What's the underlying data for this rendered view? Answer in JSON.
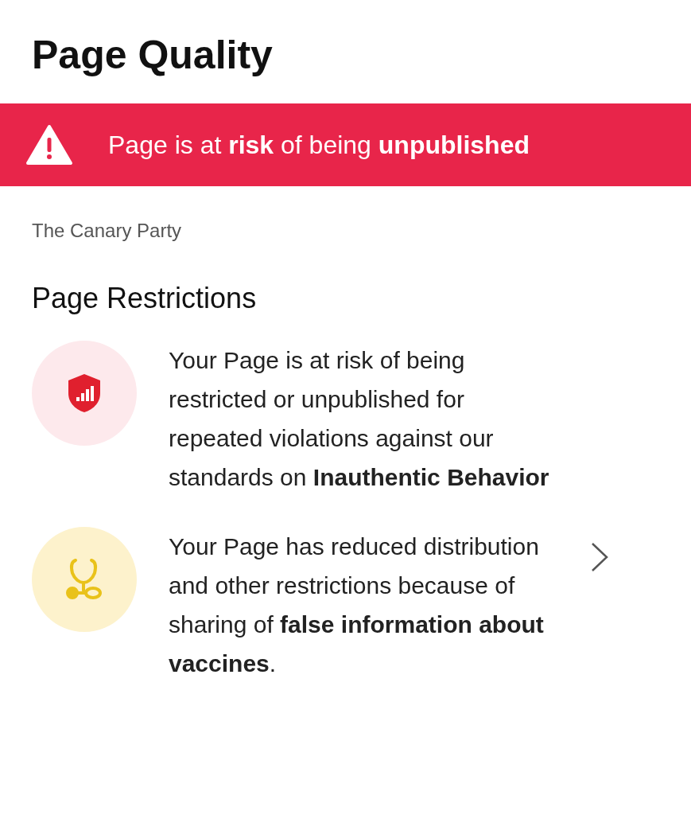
{
  "title": "Page Quality",
  "banner": {
    "text": "Page is at **risk** of being **unpublished**"
  },
  "page_name": "The Canary Party",
  "section_title": "Page Restrictions",
  "restrictions": [
    {
      "kind": "shield",
      "text": "Your Page is at risk of being restricted or unpublished for repeated violations against our standards on **Inauthentic Behavior**",
      "expandable": false
    },
    {
      "kind": "stethoscope",
      "text": "Your Page has reduced distribution and other restrictions because of sharing of **false information about vaccines**.",
      "expandable": true
    }
  ]
}
